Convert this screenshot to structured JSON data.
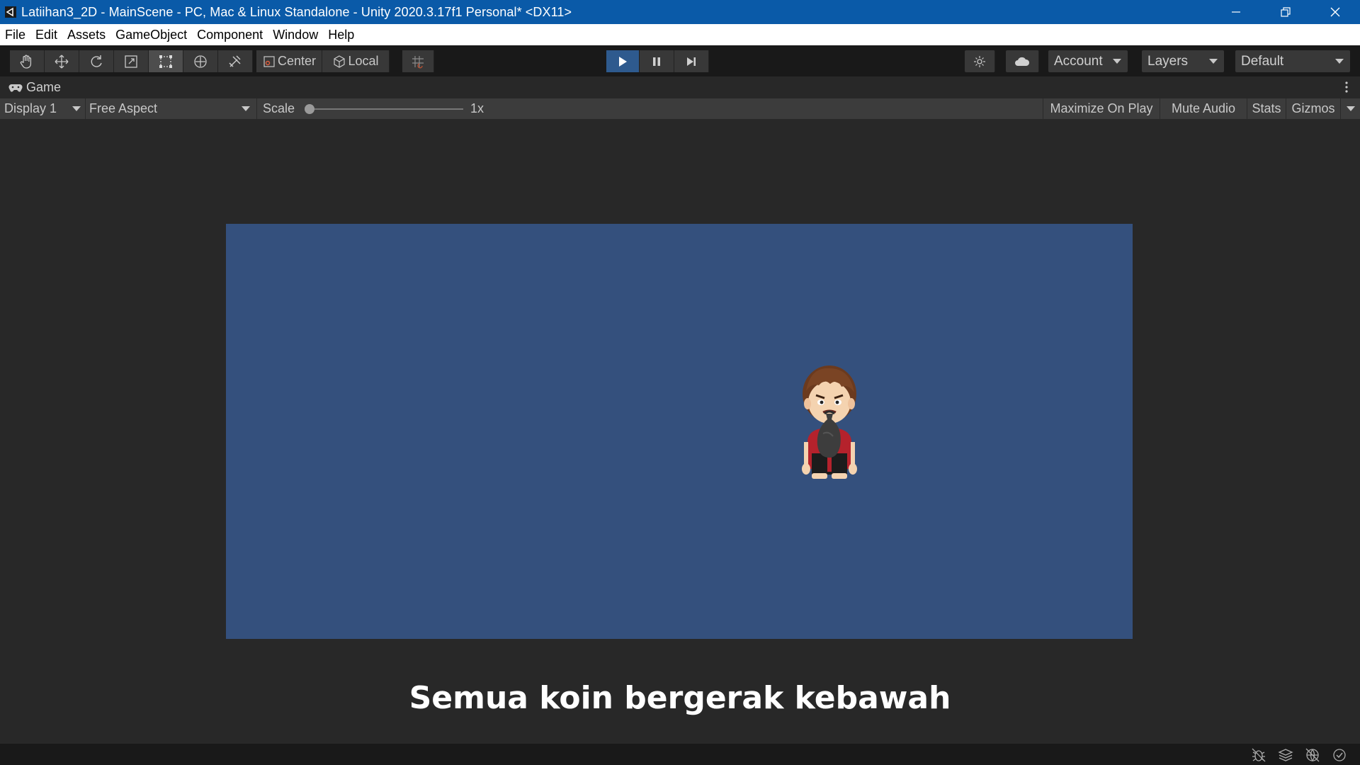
{
  "window": {
    "title": "Latiihan3_2D - MainScene - PC, Mac & Linux Standalone - Unity 2020.3.17f1 Personal* <DX11>",
    "title_bar_color": "#0a5aa8"
  },
  "menu": {
    "items": [
      "File",
      "Edit",
      "Assets",
      "GameObject",
      "Component",
      "Window",
      "Help"
    ]
  },
  "toolbar": {
    "tools": [
      "hand-tool-icon",
      "move-tool-icon",
      "rotate-tool-icon",
      "scale-tool-icon",
      "rect-tool-icon",
      "transform-tool-icon",
      "custom-tool-icon"
    ],
    "active_tool": "rect-tool-icon",
    "pivot_label": "Center",
    "space_label": "Local",
    "play_active": true,
    "account_label": "Account",
    "layers_label": "Layers",
    "layout_label": "Default"
  },
  "game_tab": {
    "label": "Game",
    "display": "Display 1",
    "aspect": "Free Aspect",
    "scale_label": "Scale",
    "scale_value": "1x",
    "maximize_on_play": "Maximize On Play",
    "mute_audio": "Mute Audio",
    "stats": "Stats",
    "gizmos": "Gizmos"
  },
  "game_view": {
    "background_color": "#34507d",
    "caption": "Semua koin bergerak kebawah"
  }
}
